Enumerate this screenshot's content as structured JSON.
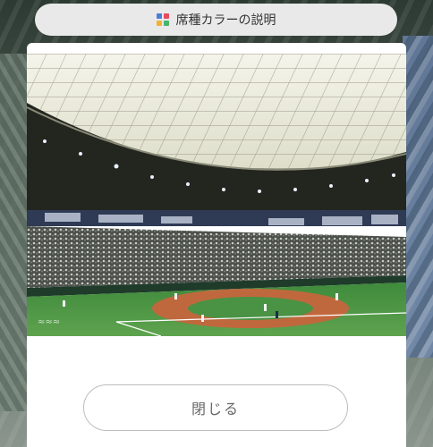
{
  "header": {
    "title": "席種カラーの説明",
    "icon": "color-legend-icon",
    "icon_colors": [
      "#4a7fd4",
      "#e84a5f",
      "#f2b134",
      "#49b36b"
    ]
  },
  "modal": {
    "photo_icon": "stadium-photo",
    "close_label": "閉じる"
  }
}
